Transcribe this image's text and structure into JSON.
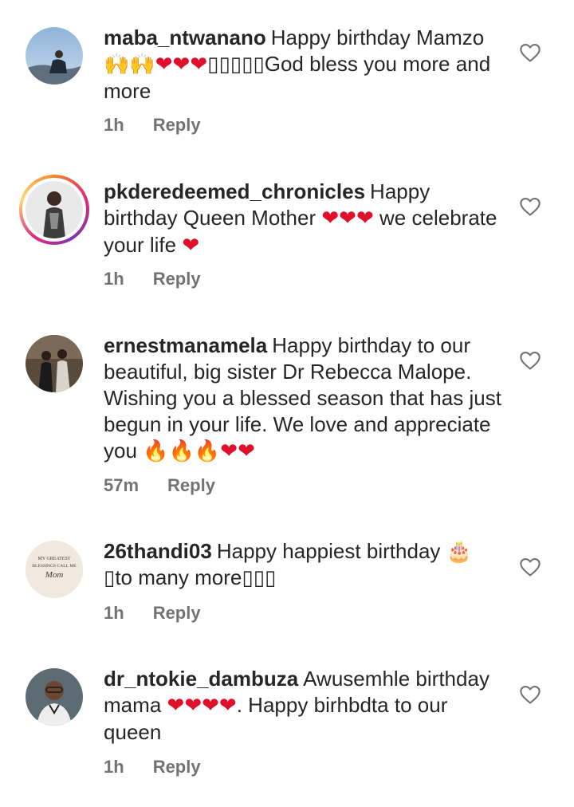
{
  "comments": [
    {
      "username": "maba_ntwanano",
      "text": "Happy birthday Mamzo 🙌🙌❤❤❤▯▯▯▯▯God bless you more and more",
      "time": "1h",
      "reply_label": "Reply"
    },
    {
      "username": "pkderedeemed_chronicles",
      "text": "Happy birthday Queen Mother ❤❤❤ we celebrate your life ❤",
      "time": "1h",
      "reply_label": "Reply"
    },
    {
      "username": "ernestmanamela",
      "text": "Happy birthday to our beautiful, big sister Dr Rebecca Malope. Wishing you a blessed season that has just begun in your life. We love and appreciate you 🔥🔥🔥❤❤",
      "time": "57m",
      "reply_label": "Reply"
    },
    {
      "username": "26thandi03",
      "text": "Happy happiest birthday 🎂 ▯to many more▯▯▯",
      "time": "1h",
      "reply_label": "Reply",
      "avatar_text": [
        "MY GREATEST",
        "BLESSINGS CALL ME",
        "Mom"
      ]
    },
    {
      "username": "dr_ntokie_dambuza",
      "text": "Awusemhle birthday mama ❤❤❤❤. Happy birhbdta to our queen",
      "time": "1h",
      "reply_label": "Reply"
    }
  ],
  "icons": {
    "like": "heart-outline-icon"
  },
  "colors": {
    "text": "#262626",
    "meta": "#737373",
    "heart": "#e0102b"
  }
}
